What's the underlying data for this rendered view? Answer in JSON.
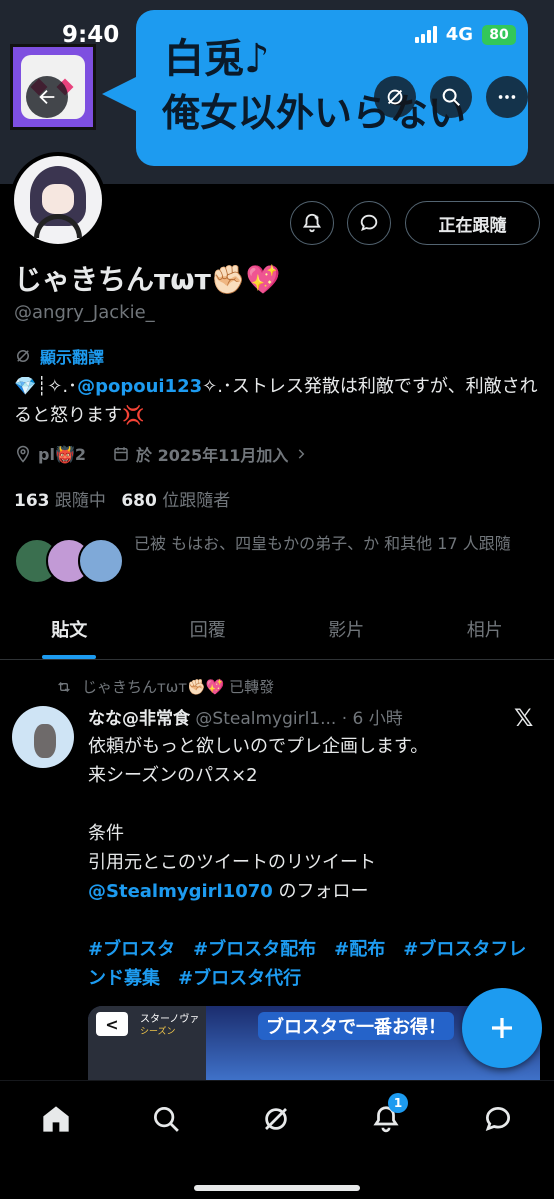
{
  "status_bar": {
    "time": "9:40",
    "network": "4G",
    "battery": "80"
  },
  "banner": {
    "line1": "白兎♪",
    "line2": "俺女以外いらない"
  },
  "profile": {
    "display_name": "じゃきちんᴛωᴛ✊🏻💖",
    "handle": "@angry_Jackie_",
    "translate_label": "顯示翻譯",
    "bio_prefix": "💎┊✧.･",
    "bio_mention": "@popoui123",
    "bio_suffix": "✧.･ストレス発散は利敵ですが、利敵されると怒ります💢",
    "location": "pl👹2",
    "joined": "於 2025年11月加入",
    "following_count": "163",
    "following_label": "跟隨中",
    "followers_count": "680",
    "followers_label": "位跟隨者",
    "known_followers": "已被 もはお、四皇もかの弟子、か 和其他 17 人跟隨"
  },
  "actions": {
    "follow_label": "正在跟隨"
  },
  "tabs": [
    "貼文",
    "回覆",
    "影片",
    "相片"
  ],
  "tweet": {
    "repost_label": "じゃきちんᴛωᴛ✊🏻💖 已轉發",
    "author_name": "なな@非常食",
    "author_handle": "@Stealmygirl1...",
    "time": "· 6 小時",
    "x_mark": "𝕏",
    "line1": "依頼がもっと欲しいのでプレ企画します。",
    "line2": "来シーズンのパス×2",
    "line3": "条件",
    "line4": "引用元とこのツイートのリツイート",
    "line5_mention": "@Stealmygirl1070",
    "line5_suffix": " のフォロー",
    "hashtags": "#ブロスタ　#ブロスタ配布　#配布　#ブロスタフレンド募集　#ブロスタ代行",
    "media_title": "スターノヴァ",
    "media_sub": "シーズン",
    "media_banner": "ブロスタで一番お得！"
  },
  "nav": {
    "notifications_badge": "1"
  },
  "icons": [
    "back-arrow-icon",
    "grok-icon",
    "search-icon",
    "more-icon",
    "notification-plus-icon",
    "message-icon",
    "translate-icon",
    "location-icon",
    "calendar-icon",
    "chevron-right-icon",
    "repost-icon",
    "x-logo",
    "plus-icon",
    "home-icon",
    "search-icon",
    "grok-icon",
    "bell-icon",
    "mail-icon"
  ],
  "colors": {
    "accent": "#1d9bf0",
    "background": "#000000",
    "muted": "#71767b",
    "text": "#e7e9ea"
  }
}
